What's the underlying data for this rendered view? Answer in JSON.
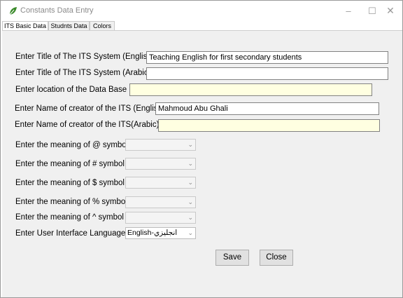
{
  "window": {
    "title": "Constants Data Entry",
    "controls": {
      "minimize": "–",
      "maximize": "☐",
      "close": "✕"
    }
  },
  "tabs": [
    {
      "label": "ITS Basic Data",
      "active": true
    },
    {
      "label": "Studnts Data",
      "active": false
    },
    {
      "label": "Colors",
      "active": false
    }
  ],
  "form": {
    "title_en": {
      "label": "Enter Title of The ITS System (English)",
      "value": "Teaching English for first secondary students"
    },
    "title_ar": {
      "label": "Enter Title of The ITS System (Arabic)",
      "value": ""
    },
    "db_location": {
      "label": "Enter location of the Data Base",
      "value": ""
    },
    "creator_en": {
      "label": "Enter Name of creator of the ITS (English)",
      "value": "Mahmoud Abu Ghali"
    },
    "creator_ar": {
      "label": "Enter Name of creator of the ITS(Arabic)",
      "value": ""
    },
    "symbol_at": {
      "label": "Enter the meaning of @ symbol",
      "value": ""
    },
    "symbol_hash": {
      "label": "Enter the meaning of # symbol",
      "value": ""
    },
    "symbol_dollar": {
      "label": "Enter the meaning of $ symbol",
      "value": ""
    },
    "symbol_percent": {
      "label": "Enter the meaning of % symbol",
      "value": ""
    },
    "symbol_caret": {
      "label": "Enter the meaning of ^ symbol",
      "value": ""
    },
    "ui_language": {
      "label": "Enter User Interface Language",
      "value": "English-انجليزي"
    }
  },
  "buttons": {
    "save": "Save",
    "close": "Close"
  },
  "colors": {
    "panel_bg": "#f0f0f0",
    "yellow_field": "#ffffe1",
    "button_bg": "#e1e1e1",
    "icon_green": "#3a8a2a"
  }
}
